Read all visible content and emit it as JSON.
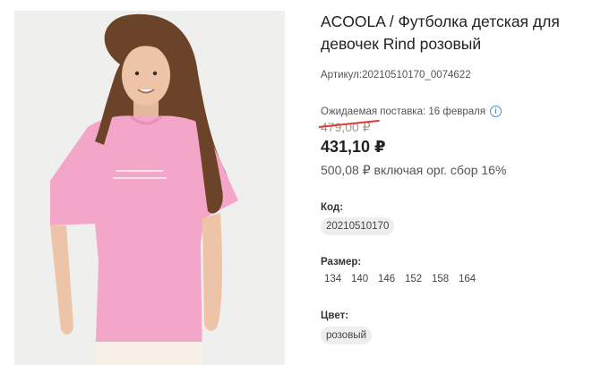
{
  "product": {
    "title": "ACOOLA / Футболка детская для девочек Rind розовый",
    "sku": "Артикул:20210510170_0074622",
    "delivery": "Ожидаемая поставка: 16 февраля",
    "old_price": "479,00 ₽",
    "price": "431,10 ₽",
    "fee_note": "500,08 ₽ включая орг. сбор 16%"
  },
  "code": {
    "label": "Код:",
    "value": "20210510170"
  },
  "size": {
    "label": "Размер:",
    "options": [
      "134",
      "140",
      "146",
      "152",
      "158",
      "164"
    ]
  },
  "color": {
    "label": "Цвет:",
    "value": "розовый"
  },
  "colors": {
    "accent_blue": "#4a8fd8",
    "strike_red": "#e53935",
    "shirt_pink": "#f4a6c8"
  }
}
